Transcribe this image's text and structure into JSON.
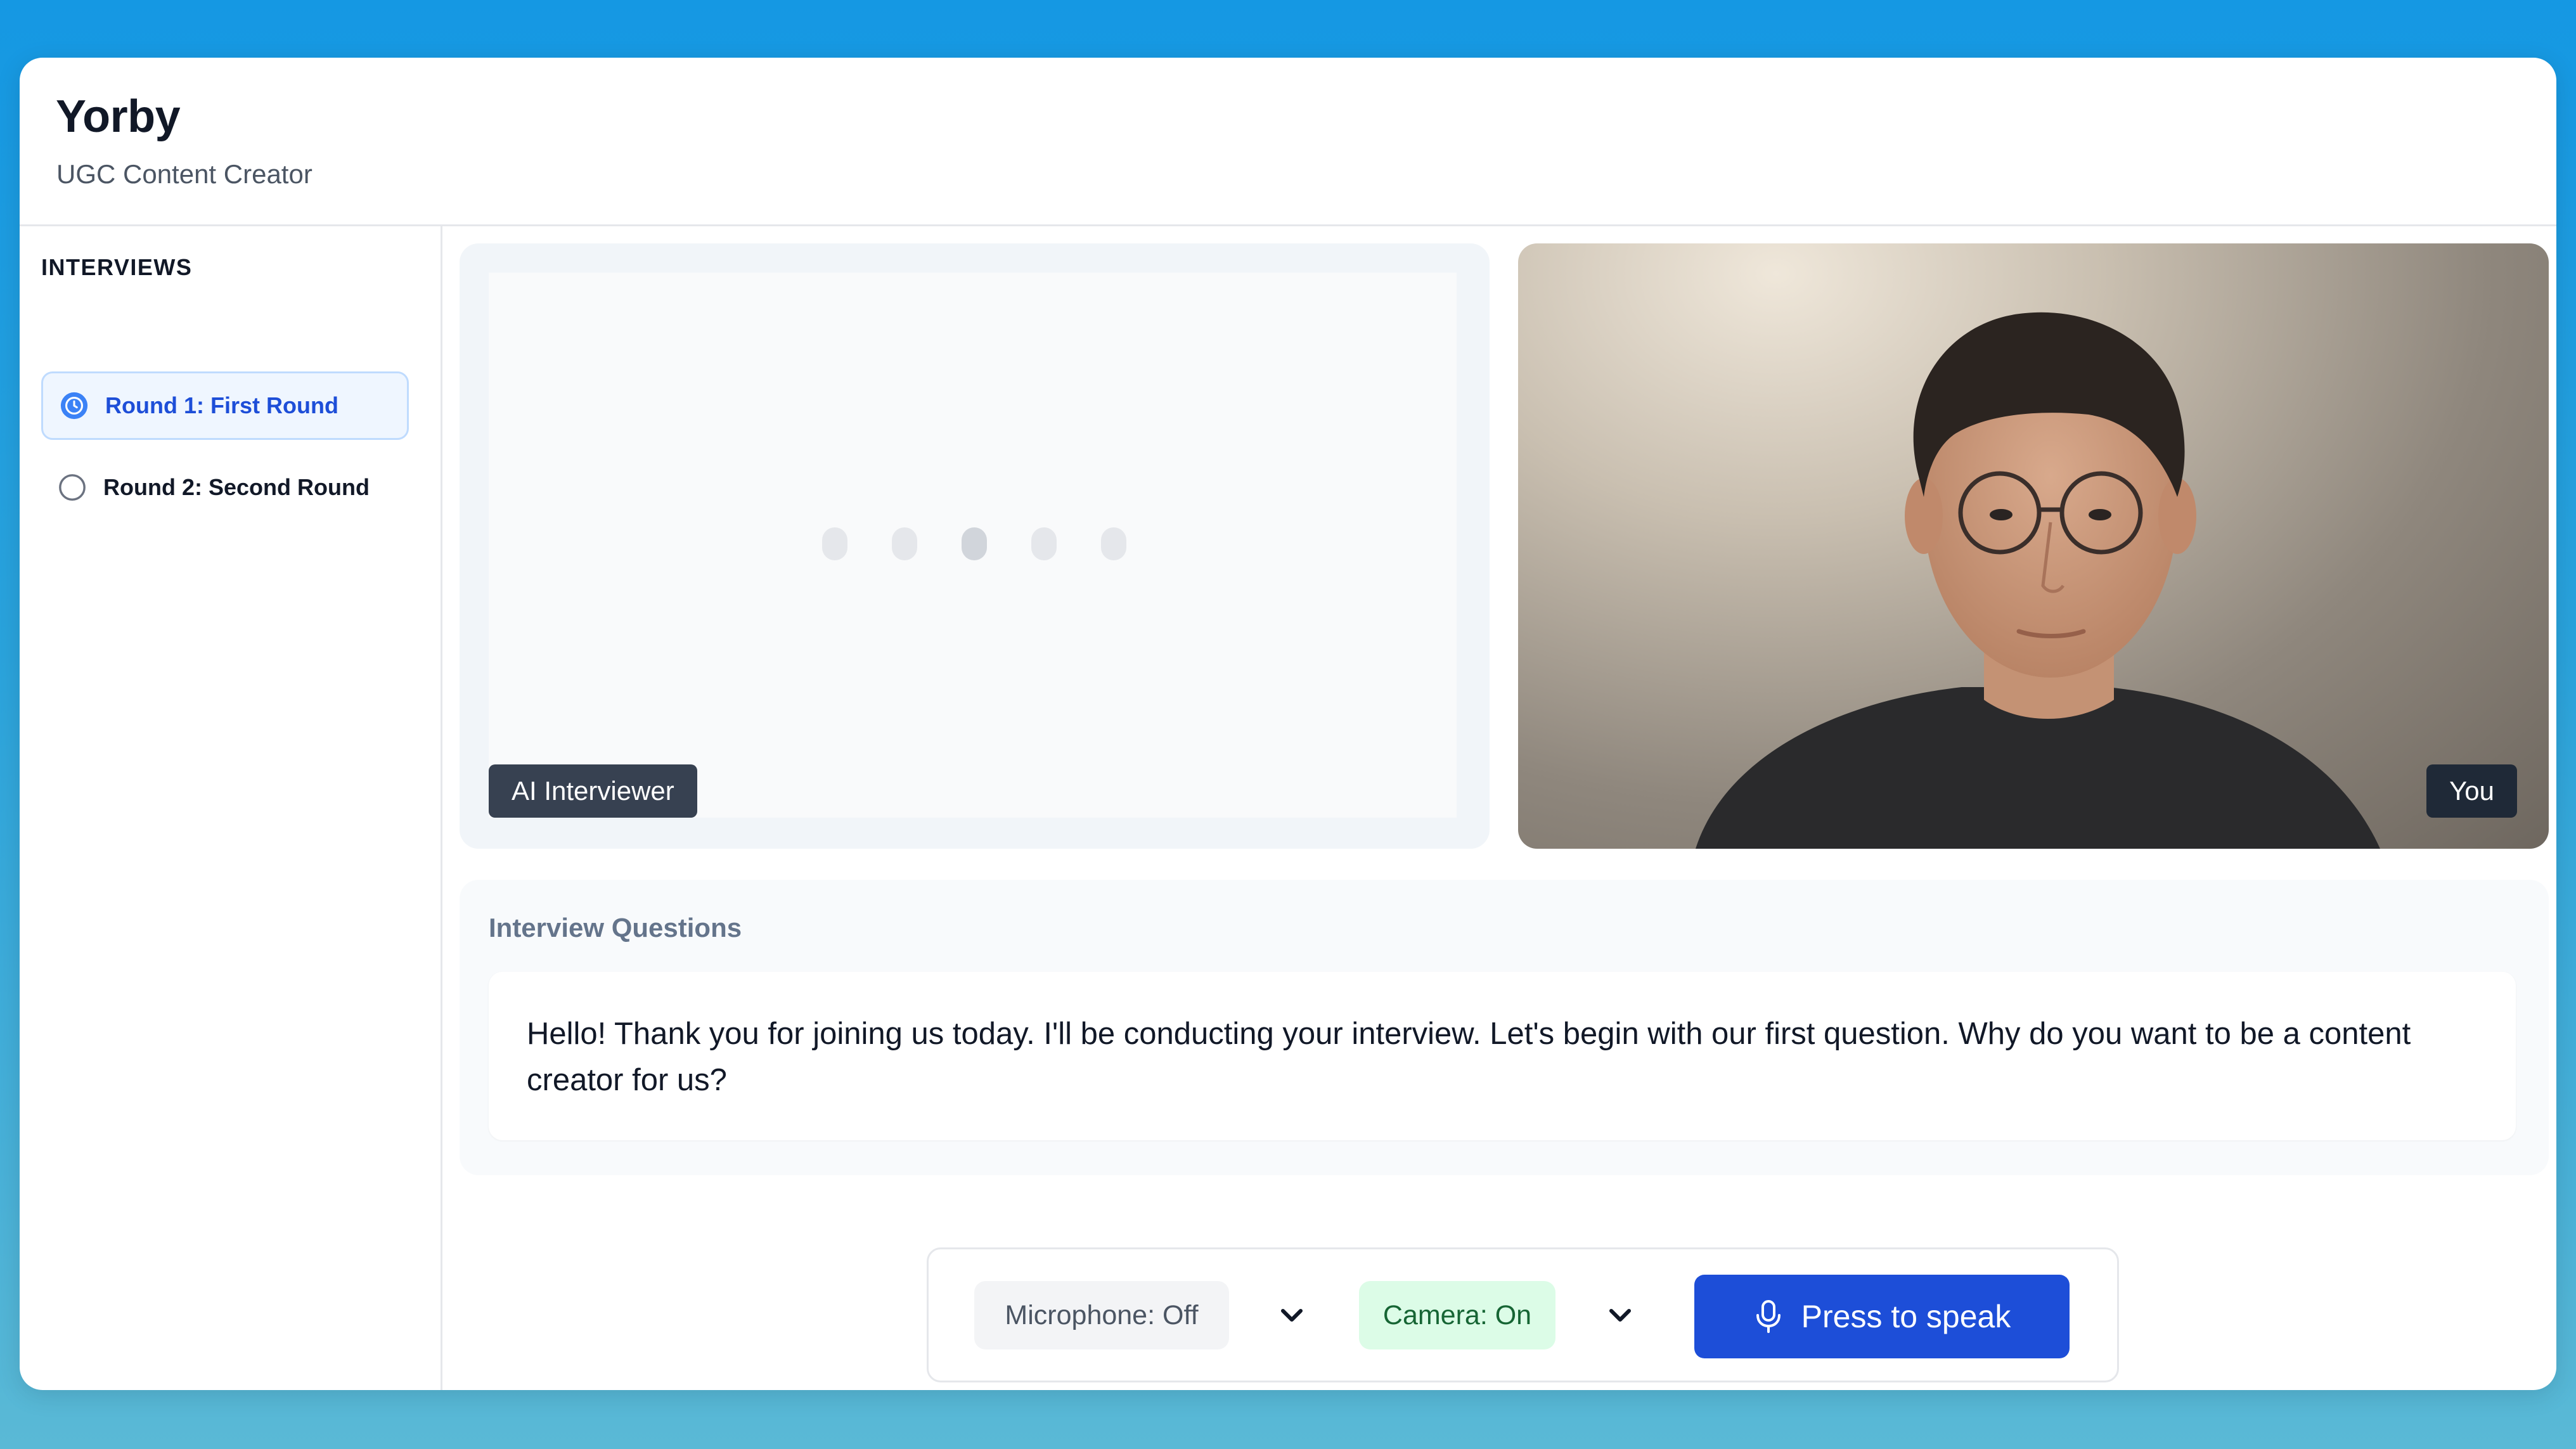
{
  "header": {
    "title": "Yorby",
    "subtitle": "UGC Content Creator"
  },
  "sidebar": {
    "heading": "INTERVIEWS",
    "items": [
      {
        "label": "Round 1: First Round",
        "status": "in-progress",
        "icon": "clock-icon",
        "active": true
      },
      {
        "label": "Round 2: Second Round",
        "status": "not-started",
        "icon": "empty-circle-icon",
        "active": false
      }
    ]
  },
  "video": {
    "ai_label": "AI Interviewer",
    "user_label": "You"
  },
  "questions": {
    "heading": "Interview Questions",
    "current": "Hello! Thank you for joining us today. I'll be conducting your interview. Let's begin with our first question. Why do you want to be a content creator for us?"
  },
  "controls": {
    "microphone": "Microphone: Off",
    "camera": "Camera: On",
    "speak_button": "Press to speak",
    "chevron_icon": "chevron-down-icon",
    "speak_icon": "microphone-icon"
  },
  "colors": {
    "accent": "#1d4ed8",
    "active_bg": "#eff6ff",
    "camera_on_bg": "#dcfce7",
    "camera_on_text": "#166534"
  }
}
